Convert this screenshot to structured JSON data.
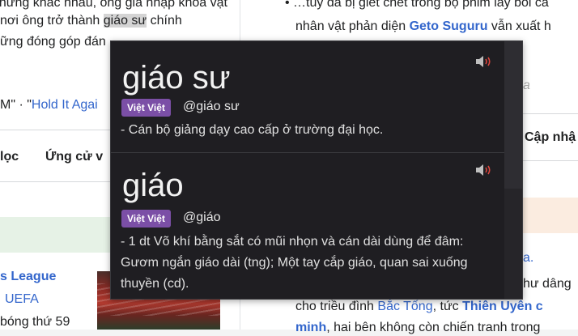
{
  "background": {
    "left_lines": [
      "những khác nhau, ông gia nhập khoa vật",
      "nơi ông trở thành",
      "giáo sư",
      "chính",
      "ững đóng góp đán",
      "M\" · \"",
      "Hold It Agai",
      "lọc",
      "Ứng cử v",
      "s League",
      "UEFA",
      "bóng thứ 59"
    ],
    "right_lines": [
      "• …tuy đã bị giết chết trong bộ phim lấy bối cả",
      "nhân vật phản diện",
      "Geto Suguru",
      "vẫn xuất h",
      "a",
      "Cập nhậ",
      "a.",
      "hư dâng",
      "cho triều đình",
      "Bắc Tống",
      ", tức",
      "Thiên Uyên c",
      "minh",
      ", hai bên không còn chiến tranh trong"
    ]
  },
  "popup": {
    "entries": [
      {
        "word": "giáo sư",
        "badge": "Việt Việt",
        "handle": "@giáo sư",
        "definition": "- Cán bộ giảng dạy cao cấp ở trường đại học.",
        "icon": "speaker-icon"
      },
      {
        "word": "giáo",
        "badge": "Việt Việt",
        "handle": "@giáo",
        "definition": "- 1 dt Võ khí bằng sắt có mũi nhọn và cán dài dùng để đâm: Gươm ngắn giáo dài (tng); Một tay cắp giáo, quan sai xuống thuyền (cd).",
        "icon": "speaker-icon"
      }
    ],
    "colors": {
      "background": "#1f1e22",
      "badge": "#7b4fa6",
      "speaker_accent": "#e0473f",
      "pointer": "#4a90d9"
    }
  }
}
